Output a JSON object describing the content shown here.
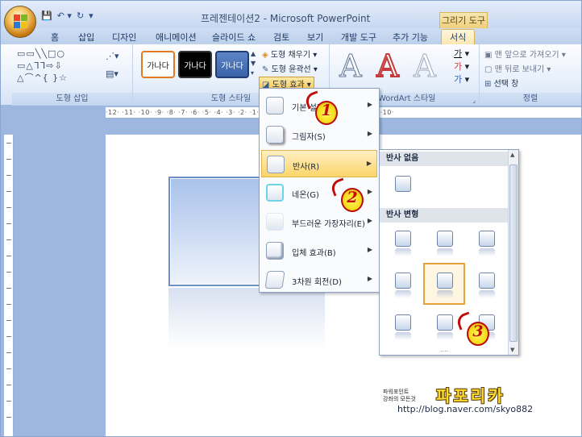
{
  "window": {
    "title": "프레젠테이션2 - Microsoft PowerPoint",
    "context_tab_title": "그리기 도구",
    "qat": [
      "💾",
      "↶ ▾",
      "↻",
      "▾"
    ]
  },
  "tabs": [
    {
      "label": "홈"
    },
    {
      "label": "삽입"
    },
    {
      "label": "디자인"
    },
    {
      "label": "애니메이션"
    },
    {
      "label": "슬라이드 쇼"
    },
    {
      "label": "검토"
    },
    {
      "label": "보기"
    },
    {
      "label": "개발 도구"
    },
    {
      "label": "추가 기능"
    },
    {
      "label": "서식"
    }
  ],
  "ribbon": {
    "shape_insert": {
      "label": "도형 삽입",
      "rows": [
        "▭▭╲╲□○",
        "▭△ᒣᒣ⇨⇩",
        "△⌒^{ }☆"
      ]
    },
    "shape_styles": {
      "label": "도형 스타일",
      "swatches": [
        "가나다",
        "가나다",
        "가나다"
      ],
      "fill": "도형 채우기 ▾",
      "outline": "도형 윤곽선 ▾",
      "effects": "도형 효과 ▾"
    },
    "wordart": {
      "label": "WordArt 스타일",
      "letters": [
        "A",
        "A",
        "A"
      ],
      "text_fill": "가",
      "text_outline": "가",
      "text_effects": "가"
    },
    "arrange": {
      "label": "정렬",
      "bring_front": "맨 앞으로 가져오기 ▾",
      "send_back": "맨 뒤로 보내기 ▾",
      "selection_pane": "선택 창"
    }
  },
  "ruler": {
    "horizontal": "·12·  ·11·  ·10·  ·9·  ·8·  ·7·  ·6·  ·5·  ·4·  ·3·  ·2·  ·1·  ·0·  ·1·  ·2·  ·3·  ·4·  ·5·  ·6·  ·7·  ·8·  ·9·  ·10·"
  },
  "effects_menu": {
    "items": [
      {
        "label": "기본 설정(P)",
        "arrow": "▶"
      },
      {
        "label": "그림자(S)",
        "arrow": "▶"
      },
      {
        "label": "반사(R)",
        "arrow": "▶"
      },
      {
        "label": "네온(G)",
        "arrow": "▶"
      },
      {
        "label": "부드러운 가장자리(E)",
        "arrow": "▶"
      },
      {
        "label": "입체 효과(B)",
        "arrow": "▶"
      },
      {
        "label": "3차원 회전(D)",
        "arrow": "▶"
      }
    ]
  },
  "reflection_submenu": {
    "no_reflection_header": "반사 없음",
    "variations_header": "반사 변형",
    "grip": "....",
    "selected_row": 1,
    "selected_col": 1
  },
  "markers": [
    "1",
    "2",
    "3"
  ],
  "watermark": {
    "small_line1": "파워포인트",
    "small_line2": "강좌의 모든것",
    "brand": "파포리카",
    "url": "http://blog.naver.com/skyo882"
  },
  "colors": {
    "accent_highlight": "#fbd46a",
    "selection_border": "#e8a13a",
    "marker_yellow": "#f5dc1d",
    "marker_red": "#c20c0c"
  }
}
